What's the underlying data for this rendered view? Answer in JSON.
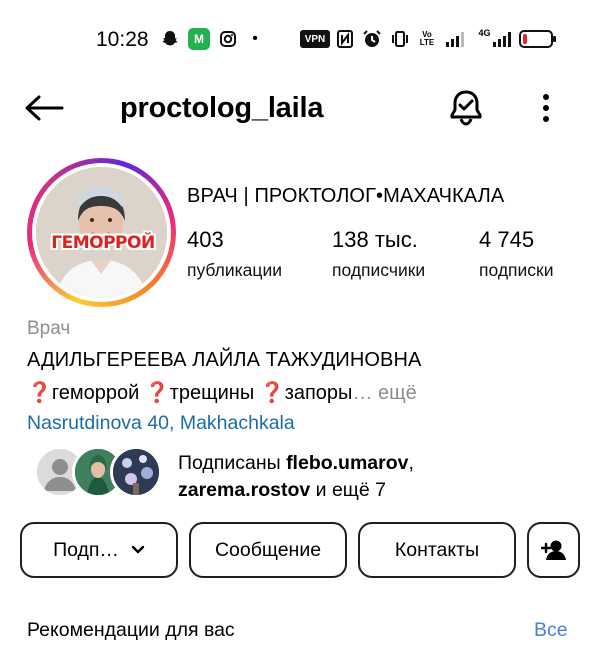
{
  "status_bar": {
    "time": "10:28",
    "app_badge": "M",
    "vpn": "VPN",
    "volte_top": "Vo",
    "volte_bottom": "LTE",
    "network": "4G",
    "icons": [
      "snapchat-icon",
      "app-icon",
      "instagram-icon",
      "dot-icon",
      "vpn-icon",
      "nfc-icon",
      "alarm-icon",
      "vibrate-icon",
      "volte-icon",
      "signal-icon",
      "signal-4g-icon",
      "battery-icon"
    ],
    "battery_level": 0.15,
    "battery_color": "#e5232a"
  },
  "header": {
    "username": "proctolog_laila"
  },
  "profile": {
    "avatar_caption": "ГЕМОРРОЙ",
    "display_name": "ВРАЧ | ПРОКТОЛОГ•МАХАЧКАЛА",
    "stats": [
      {
        "value": "403",
        "label": "публикации"
      },
      {
        "value": "138 тыс.",
        "label": "подписчики"
      },
      {
        "value": "4 745",
        "label": "подписки"
      }
    ],
    "category": "Врач",
    "full_name": "АДИЛЬГЕРЕЕВА ЛАЙЛА ТАЖУДИНОВНА",
    "bio": {
      "q1": "❓",
      "t1": "геморрой ",
      "q2": "❓",
      "t2": "трещины ",
      "q3": "❓",
      "t3": "запоры",
      "more": "… ещё"
    },
    "location": "Nasrutdinova 40, Makhachkala",
    "followed_by": {
      "prefix": "Подписаны ",
      "user1": "flebo.umarov",
      "sep": ",",
      "user2": "zarema.rostov",
      "suffix": " и ещё 7"
    }
  },
  "actions": {
    "follow_label": "Подп…",
    "message_label": "Сообщение",
    "contacts_label": "Контакты"
  },
  "suggestions": {
    "title": "Рекомендации для вас",
    "see_all": "Все"
  },
  "colors": {
    "link": "#1b6ca8",
    "accent": "#4a7fd6",
    "muted": "#8e8e8e",
    "avatar_caption": "#e0201f"
  }
}
